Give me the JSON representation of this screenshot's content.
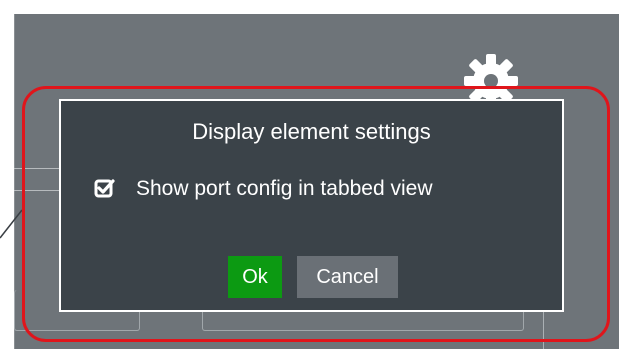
{
  "dialog": {
    "title": "Display element settings",
    "checkbox": {
      "label": "Show port config in tabbed view",
      "checked": true
    },
    "ok_label": "Ok",
    "cancel_label": "Cancel"
  },
  "colors": {
    "background": "#6e7479",
    "dialog_bg": "#3b4349",
    "ok_button": "#0c9a12",
    "cancel_button": "#6a7076",
    "highlight": "#e0151b"
  },
  "icons": {
    "settings": "gear-icon",
    "checkbox": "checkbox-checked-icon"
  }
}
